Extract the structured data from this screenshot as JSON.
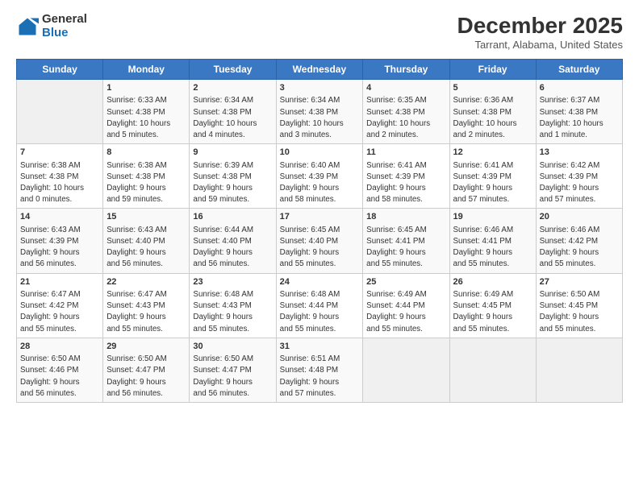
{
  "header": {
    "logo_general": "General",
    "logo_blue": "Blue",
    "title": "December 2025",
    "location": "Tarrant, Alabama, United States"
  },
  "calendar": {
    "days": [
      "Sunday",
      "Monday",
      "Tuesday",
      "Wednesday",
      "Thursday",
      "Friday",
      "Saturday"
    ],
    "weeks": [
      [
        {
          "day": "",
          "content": ""
        },
        {
          "day": "1",
          "content": "Sunrise: 6:33 AM\nSunset: 4:38 PM\nDaylight: 10 hours\nand 5 minutes."
        },
        {
          "day": "2",
          "content": "Sunrise: 6:34 AM\nSunset: 4:38 PM\nDaylight: 10 hours\nand 4 minutes."
        },
        {
          "day": "3",
          "content": "Sunrise: 6:34 AM\nSunset: 4:38 PM\nDaylight: 10 hours\nand 3 minutes."
        },
        {
          "day": "4",
          "content": "Sunrise: 6:35 AM\nSunset: 4:38 PM\nDaylight: 10 hours\nand 2 minutes."
        },
        {
          "day": "5",
          "content": "Sunrise: 6:36 AM\nSunset: 4:38 PM\nDaylight: 10 hours\nand 2 minutes."
        },
        {
          "day": "6",
          "content": "Sunrise: 6:37 AM\nSunset: 4:38 PM\nDaylight: 10 hours\nand 1 minute."
        }
      ],
      [
        {
          "day": "7",
          "content": "Sunrise: 6:38 AM\nSunset: 4:38 PM\nDaylight: 10 hours\nand 0 minutes."
        },
        {
          "day": "8",
          "content": "Sunrise: 6:38 AM\nSunset: 4:38 PM\nDaylight: 9 hours\nand 59 minutes."
        },
        {
          "day": "9",
          "content": "Sunrise: 6:39 AM\nSunset: 4:38 PM\nDaylight: 9 hours\nand 59 minutes."
        },
        {
          "day": "10",
          "content": "Sunrise: 6:40 AM\nSunset: 4:39 PM\nDaylight: 9 hours\nand 58 minutes."
        },
        {
          "day": "11",
          "content": "Sunrise: 6:41 AM\nSunset: 4:39 PM\nDaylight: 9 hours\nand 58 minutes."
        },
        {
          "day": "12",
          "content": "Sunrise: 6:41 AM\nSunset: 4:39 PM\nDaylight: 9 hours\nand 57 minutes."
        },
        {
          "day": "13",
          "content": "Sunrise: 6:42 AM\nSunset: 4:39 PM\nDaylight: 9 hours\nand 57 minutes."
        }
      ],
      [
        {
          "day": "14",
          "content": "Sunrise: 6:43 AM\nSunset: 4:39 PM\nDaylight: 9 hours\nand 56 minutes."
        },
        {
          "day": "15",
          "content": "Sunrise: 6:43 AM\nSunset: 4:40 PM\nDaylight: 9 hours\nand 56 minutes."
        },
        {
          "day": "16",
          "content": "Sunrise: 6:44 AM\nSunset: 4:40 PM\nDaylight: 9 hours\nand 56 minutes."
        },
        {
          "day": "17",
          "content": "Sunrise: 6:45 AM\nSunset: 4:40 PM\nDaylight: 9 hours\nand 55 minutes."
        },
        {
          "day": "18",
          "content": "Sunrise: 6:45 AM\nSunset: 4:41 PM\nDaylight: 9 hours\nand 55 minutes."
        },
        {
          "day": "19",
          "content": "Sunrise: 6:46 AM\nSunset: 4:41 PM\nDaylight: 9 hours\nand 55 minutes."
        },
        {
          "day": "20",
          "content": "Sunrise: 6:46 AM\nSunset: 4:42 PM\nDaylight: 9 hours\nand 55 minutes."
        }
      ],
      [
        {
          "day": "21",
          "content": "Sunrise: 6:47 AM\nSunset: 4:42 PM\nDaylight: 9 hours\nand 55 minutes."
        },
        {
          "day": "22",
          "content": "Sunrise: 6:47 AM\nSunset: 4:43 PM\nDaylight: 9 hours\nand 55 minutes."
        },
        {
          "day": "23",
          "content": "Sunrise: 6:48 AM\nSunset: 4:43 PM\nDaylight: 9 hours\nand 55 minutes."
        },
        {
          "day": "24",
          "content": "Sunrise: 6:48 AM\nSunset: 4:44 PM\nDaylight: 9 hours\nand 55 minutes."
        },
        {
          "day": "25",
          "content": "Sunrise: 6:49 AM\nSunset: 4:44 PM\nDaylight: 9 hours\nand 55 minutes."
        },
        {
          "day": "26",
          "content": "Sunrise: 6:49 AM\nSunset: 4:45 PM\nDaylight: 9 hours\nand 55 minutes."
        },
        {
          "day": "27",
          "content": "Sunrise: 6:50 AM\nSunset: 4:45 PM\nDaylight: 9 hours\nand 55 minutes."
        }
      ],
      [
        {
          "day": "28",
          "content": "Sunrise: 6:50 AM\nSunset: 4:46 PM\nDaylight: 9 hours\nand 56 minutes."
        },
        {
          "day": "29",
          "content": "Sunrise: 6:50 AM\nSunset: 4:47 PM\nDaylight: 9 hours\nand 56 minutes."
        },
        {
          "day": "30",
          "content": "Sunrise: 6:50 AM\nSunset: 4:47 PM\nDaylight: 9 hours\nand 56 minutes."
        },
        {
          "day": "31",
          "content": "Sunrise: 6:51 AM\nSunset: 4:48 PM\nDaylight: 9 hours\nand 57 minutes."
        },
        {
          "day": "",
          "content": ""
        },
        {
          "day": "",
          "content": ""
        },
        {
          "day": "",
          "content": ""
        }
      ]
    ]
  }
}
